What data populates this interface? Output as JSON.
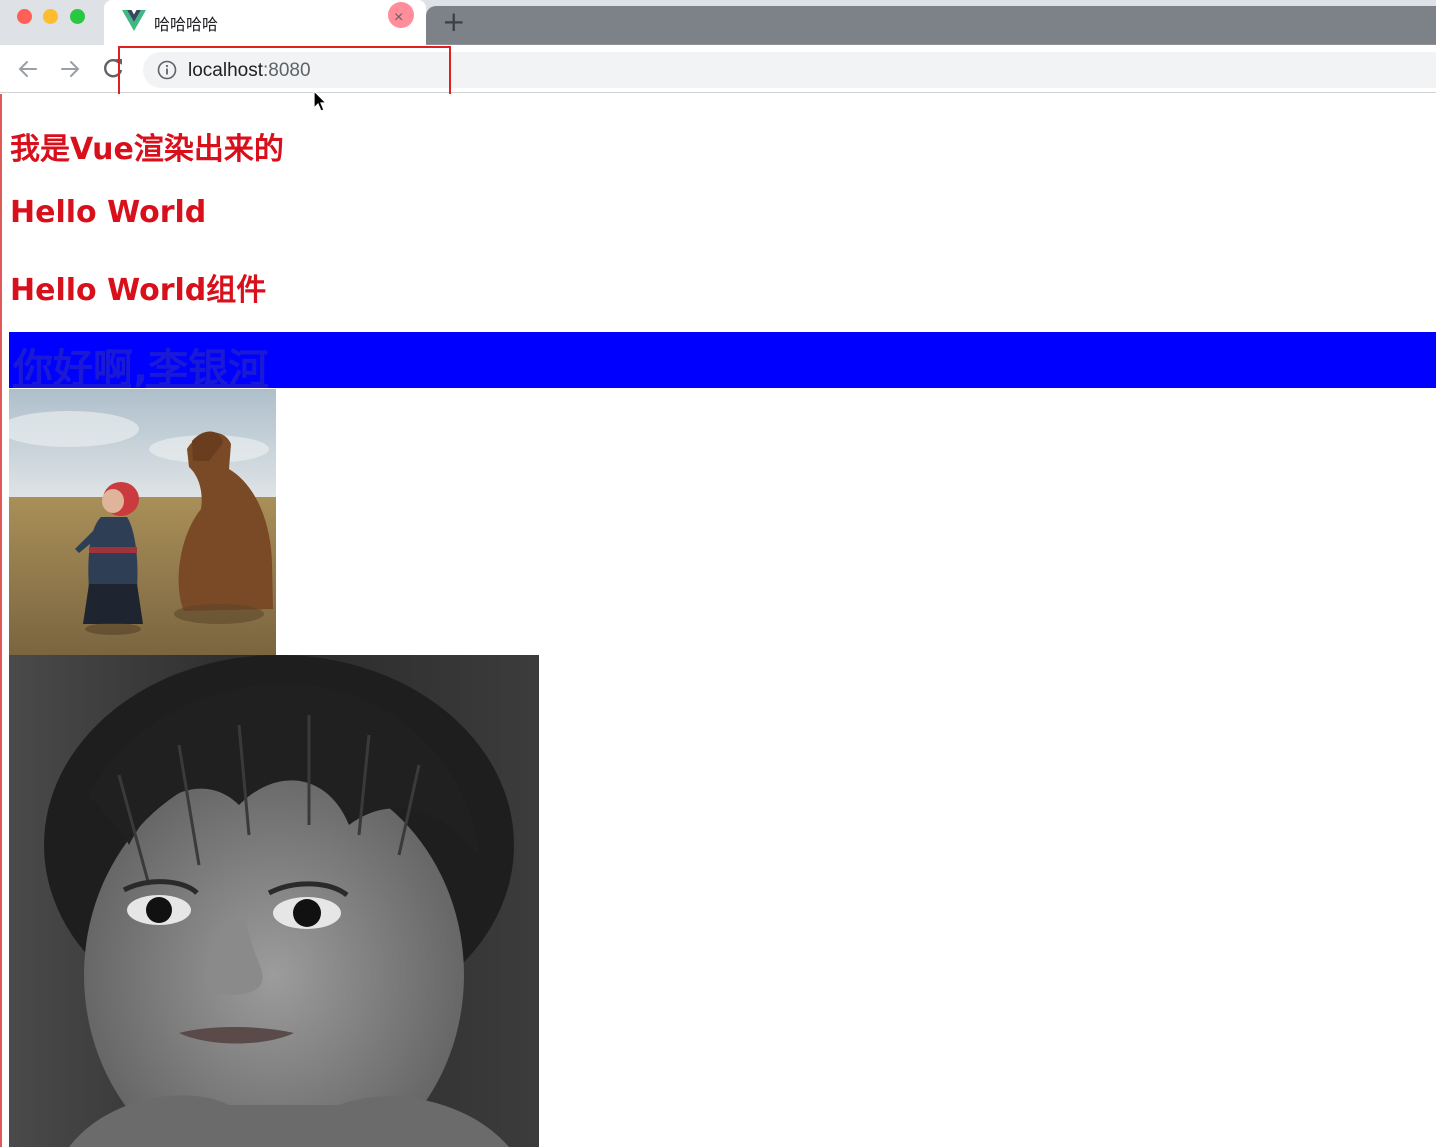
{
  "browser": {
    "tab": {
      "title": "哈哈哈哈",
      "close_glyph": "×",
      "favicon": "vue-logo-icon"
    },
    "new_tab_glyph": "+",
    "address_bar": {
      "host": "localhost",
      "port": ":8080",
      "icon": "info-icon"
    },
    "nav": {
      "back": "arrow-left-icon",
      "forward": "arrow-right-icon",
      "reload": "reload-icon"
    },
    "colors": {
      "highlight": "#e02020"
    }
  },
  "page": {
    "heading_1": "我是Vue渲染出来的",
    "heading_2": "Hello World",
    "heading_3": "Hello World组件",
    "banner_link": "你好啊,李银河",
    "colors": {
      "heading": "#d8101c",
      "banner_bg": "#0000ff",
      "banner_text": "#1a1ad6"
    },
    "images": [
      {
        "name": "child-with-camel-photo"
      },
      {
        "name": "child-portrait-bw-photo"
      }
    ]
  }
}
